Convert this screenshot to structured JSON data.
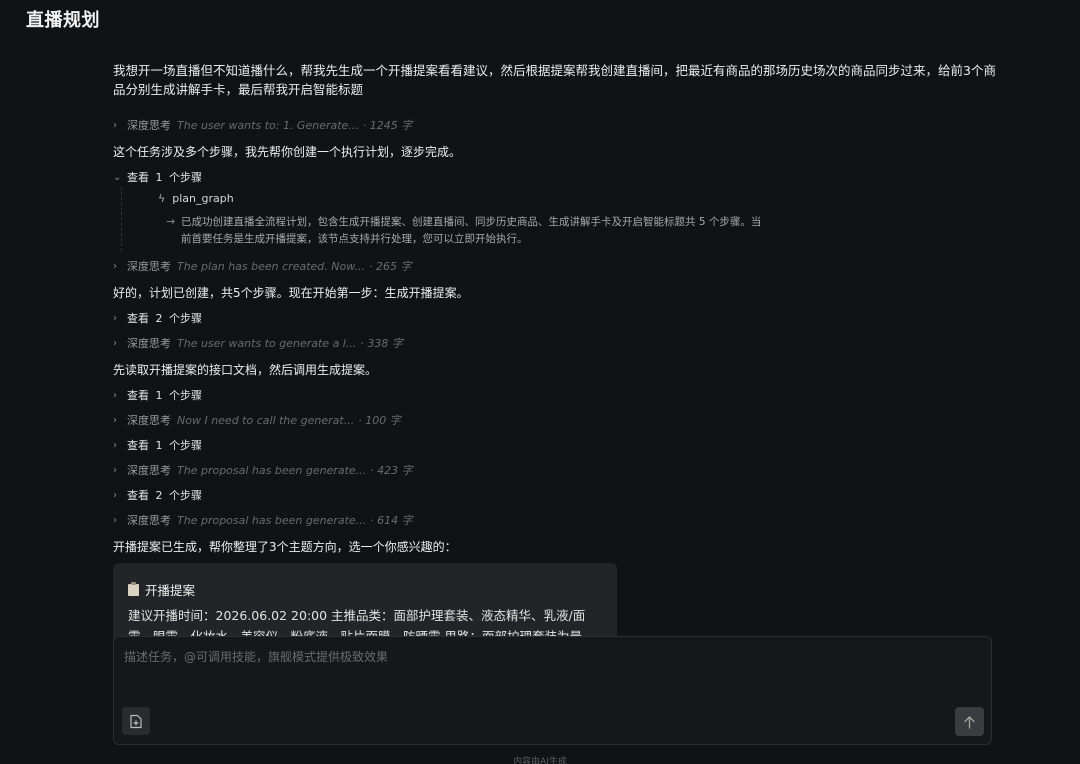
{
  "page_title": "直播规划",
  "user_prompt": "我想开一场直播但不知道播什么，帮我先生成一个开播提案看看建议，然后根据提案帮我创建直播间，把最近有商品的那场历史场次的商品同步过来，给前3个商品分别生成讲解手卡，最后帮我开启智能标题",
  "think_label": "深度思考",
  "steps_prefix": "查看",
  "steps_suffix": "个步骤",
  "thinking": [
    {
      "snippet": "The user wants to: 1. Generate...",
      "count": "· 1245 字"
    },
    {
      "snippet": "The plan has been created. Now...",
      "count": "· 265 字"
    },
    {
      "snippet": "The user wants to generate a l...",
      "count": "· 338 字"
    },
    {
      "snippet": "Now I need to call the generat...",
      "count": "· 100 字"
    },
    {
      "snippet": "The proposal has been generate...",
      "count": "· 423 字"
    },
    {
      "snippet": "The proposal has been generate...",
      "count": "· 614 字"
    }
  ],
  "steps": [
    "1",
    "2",
    "1",
    "1",
    "2"
  ],
  "messages": [
    "这个任务涉及多个步骤，我先帮你创建一个执行计划，逐步完成。",
    "好的，计划已创建，共5个步骤。现在开始第一步：生成开播提案。",
    "先读取开播提案的接口文档，然后调用生成提案。",
    "开播提案已生成，帮你整理了3个主题方向，选一个你感兴趣的："
  ],
  "tool": {
    "name": "plan_graph",
    "result": "已成功创建直播全流程计划，包含生成开播提案、创建直播间、同步历史商品、生成讲解手卡及开启智能标题共 5 个步骤。当前首要任务是生成开播提案，该节点支持并行处理，您可以立即开始执行。"
  },
  "proposal_card": {
    "title": "开播提案",
    "body": "建议开播时间：2026.06.02 20:00 主推品类：面部护理套装、液态精华、乳液/面霜、眼霜、化妆水、美容仪、粉底液、贴片面膜、防晒霜 思路：面部护理套装为最"
  },
  "composer": {
    "placeholder": "描述任务，@可调用技能，旗舰模式提供极致效果"
  },
  "footer_note": "内容由AI生成"
}
